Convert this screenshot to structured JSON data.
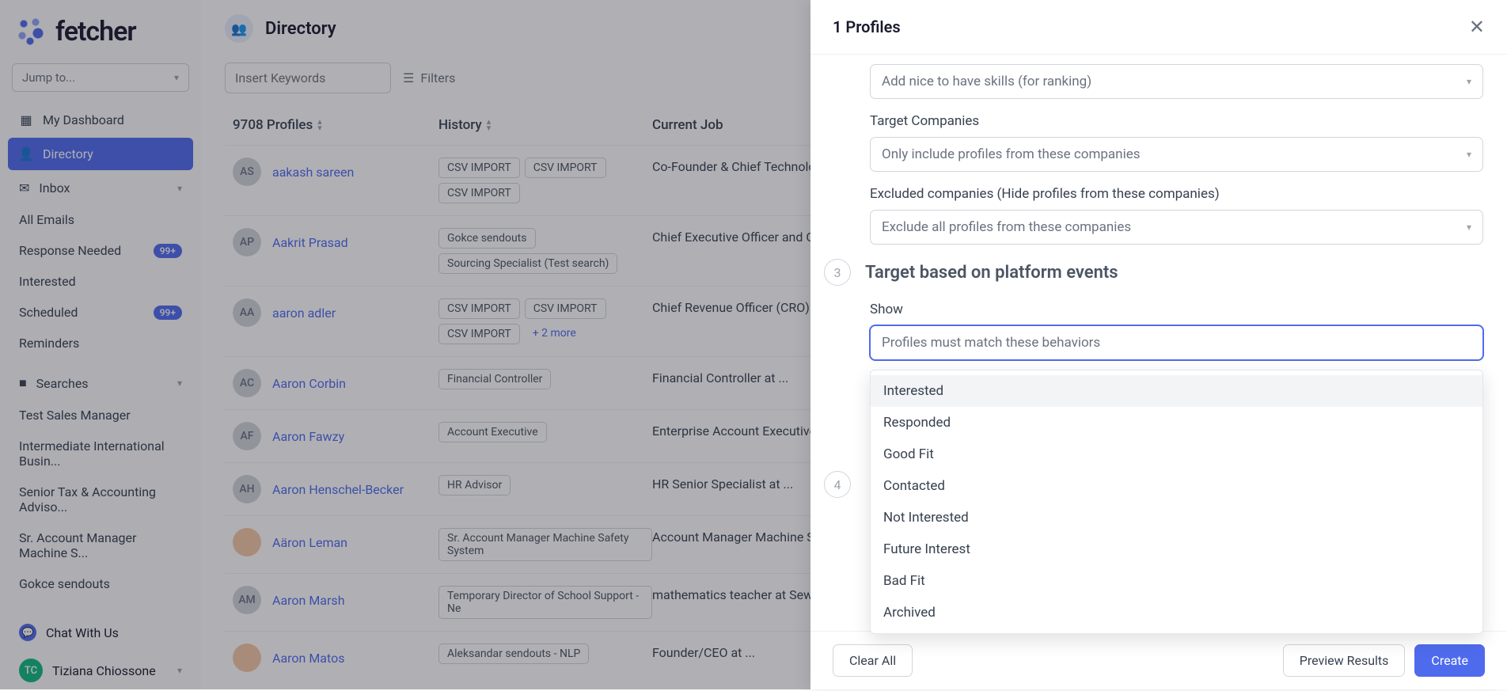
{
  "logo": {
    "text": "fetcher"
  },
  "jumpto": {
    "placeholder": "Jump to..."
  },
  "nav": {
    "dashboard": "My Dashboard",
    "directory": "Directory",
    "inbox": "Inbox",
    "subs": [
      {
        "label": "All Emails"
      },
      {
        "label": "Response Needed",
        "badge": "99+"
      },
      {
        "label": "Interested"
      },
      {
        "label": "Scheduled",
        "badge": "99+"
      },
      {
        "label": "Reminders"
      }
    ],
    "searches": "Searches",
    "search_items": [
      "Test Sales Manager",
      "Intermediate International Busin...",
      "Senior Tax & Accounting Adviso...",
      "Sr. Account Manager Machine S...",
      "Gokce sendouts"
    ],
    "chat": "Chat With Us",
    "user": {
      "initials": "TC",
      "name": "Tiziana Chiossone"
    }
  },
  "main": {
    "title": "Directory",
    "keywords_placeholder": "Insert Keywords",
    "filters": "Filters",
    "cols": {
      "profiles": "9708 Profiles",
      "history": "History",
      "job": "Current Job"
    },
    "rows": [
      {
        "initials": "AS",
        "name": "aakash sareen",
        "tags": [
          "CSV IMPORT",
          "CSV IMPORT",
          "CSV IMPORT"
        ],
        "job": "Co-Founder & Chief Technology Officer at C..."
      },
      {
        "initials": "AP",
        "name": "Aakrit Prasad",
        "tags": [
          "Gokce sendouts",
          "Sourcing Specialist (Test search)"
        ],
        "job": "Chief Executive Officer and Co-Founder at ..."
      },
      {
        "initials": "AA",
        "name": "aaron adler",
        "tags": [
          "CSV IMPORT",
          "CSV IMPORT",
          "CSV IMPORT"
        ],
        "more": "+ 2 more",
        "job": "Chief Revenue Officer (CRO) at ..."
      },
      {
        "initials": "AC",
        "name": "Aaron Corbin",
        "tags": [
          "Financial Controller"
        ],
        "job": "Financial Controller at ..."
      },
      {
        "initials": "AF",
        "name": "Aaron Fawzy",
        "tags": [
          "Account Executive"
        ],
        "job": "Enterprise Account Executive at LinkedIn"
      },
      {
        "initials": "AH",
        "name": "Aaron Henschel-Becker",
        "tags": [
          "HR Advisor"
        ],
        "job": "HR Senior Specialist at ..."
      },
      {
        "initials": "",
        "photo": true,
        "name": "Aäron Leman",
        "tags": [
          "Sr. Account Manager Machine Safety System"
        ],
        "job": "Account Manager Machine Safety & Industrial Automation ..."
      },
      {
        "initials": "AM",
        "name": "Aaron Marsh",
        "tags": [
          "Temporary Director of School Support - Ne"
        ],
        "job": "mathematics teacher at Sewanhaka ..."
      },
      {
        "initials": "",
        "photo": true,
        "name": "Aaron Matos",
        "tags": [
          "Aleksandar sendouts - NLP"
        ],
        "job": "Founder/CEO at ..."
      }
    ]
  },
  "panel": {
    "title": "1 Profiles",
    "skills_placeholder": "Add nice to have skills (for ranking)",
    "target_companies_label": "Target Companies",
    "target_companies_placeholder": "Only include profiles from these companies",
    "excluded_label": "Excluded companies (Hide profiles from these companies)",
    "excluded_placeholder": "Exclude all profiles from these companies",
    "step3": {
      "num": "3",
      "title": "Target based on platform events"
    },
    "step4": {
      "num": "4"
    },
    "show_label": "Show",
    "show_placeholder": "Profiles must match these behaviors",
    "options": [
      "Interested",
      "Responded",
      "Good Fit",
      "Contacted",
      "Not Interested",
      "Future Interest",
      "Bad Fit",
      "Archived"
    ],
    "footer": {
      "clear": "Clear All",
      "preview": "Preview Results",
      "create": "Create"
    }
  }
}
